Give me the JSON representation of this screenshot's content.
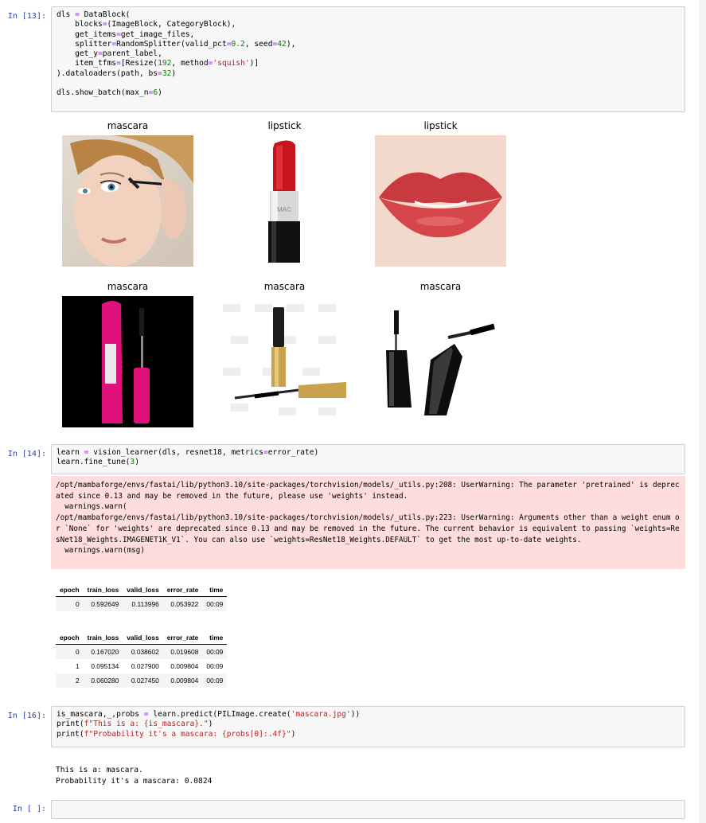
{
  "cells": {
    "c13": {
      "prompt": "In [13]:",
      "code_lines": [
        "dls = DataBlock(",
        "    blocks=(ImageBlock, CategoryBlock),",
        "    get_items=get_image_files,",
        "    splitter=RandomSplitter(valid_pct=0.2, seed=42),",
        "    get_y=parent_label,",
        "    item_tfms=[Resize(192, method='squish')]",
        ").dataloaders(path, bs=32)",
        "",
        "dls.show_batch(max_n=6)"
      ],
      "batch_labels": [
        "mascara",
        "lipstick",
        "lipstick",
        "mascara",
        "mascara",
        "mascara"
      ]
    },
    "c14": {
      "prompt": "In [14]:",
      "code_lines": [
        "learn = vision_learner(dls, resnet18, metrics=error_rate)",
        "learn.fine_tune(3)"
      ],
      "stderr": "/opt/mambaforge/envs/fastai/lib/python3.10/site-packages/torchvision/models/_utils.py:208: UserWarning: The parameter 'pretrained' is deprecated since 0.13 and may be removed in the future, please use 'weights' instead.\n  warnings.warn(\n/opt/mambaforge/envs/fastai/lib/python3.10/site-packages/torchvision/models/_utils.py:223: UserWarning: Arguments other than a weight enum or `None` for 'weights' are deprecated since 0.13 and may be removed in the future. The current behavior is equivalent to passing `weights=ResNet18_Weights.IMAGENET1K_V1`. You can also use `weights=ResNet18_Weights.DEFAULT` to get the most up-to-date weights.\n  warnings.warn(msg)",
      "table_headers": [
        "epoch",
        "train_loss",
        "valid_loss",
        "error_rate",
        "time"
      ],
      "table1_rows": [
        [
          "0",
          "0.592649",
          "0.113996",
          "0.053922",
          "00:09"
        ]
      ],
      "table2_rows": [
        [
          "0",
          "0.167020",
          "0.038602",
          "0.019608",
          "00:09"
        ],
        [
          "1",
          "0.095134",
          "0.027900",
          "0.009804",
          "00:09"
        ],
        [
          "2",
          "0.060280",
          "0.027450",
          "0.009804",
          "00:09"
        ]
      ]
    },
    "c16": {
      "prompt": "In [16]:",
      "code_lines": [
        "is_mascara,_,probs = learn.predict(PILImage.create('mascara.jpg'))",
        "print(f\"This is a: {is_mascara}.\")",
        "print(f\"Probability it's a mascara: {probs[0]:.4f}\")"
      ],
      "stdout": "This is a: mascara.\nProbability it's a mascara: 0.0824"
    },
    "empty": {
      "prompt": "In [ ]:"
    }
  },
  "colors": {
    "prompt": "#303F9F",
    "code_bg": "#f7f7f7",
    "stderr_bg": "#ffdddd",
    "string": "#BA2121",
    "number": "#008000"
  }
}
